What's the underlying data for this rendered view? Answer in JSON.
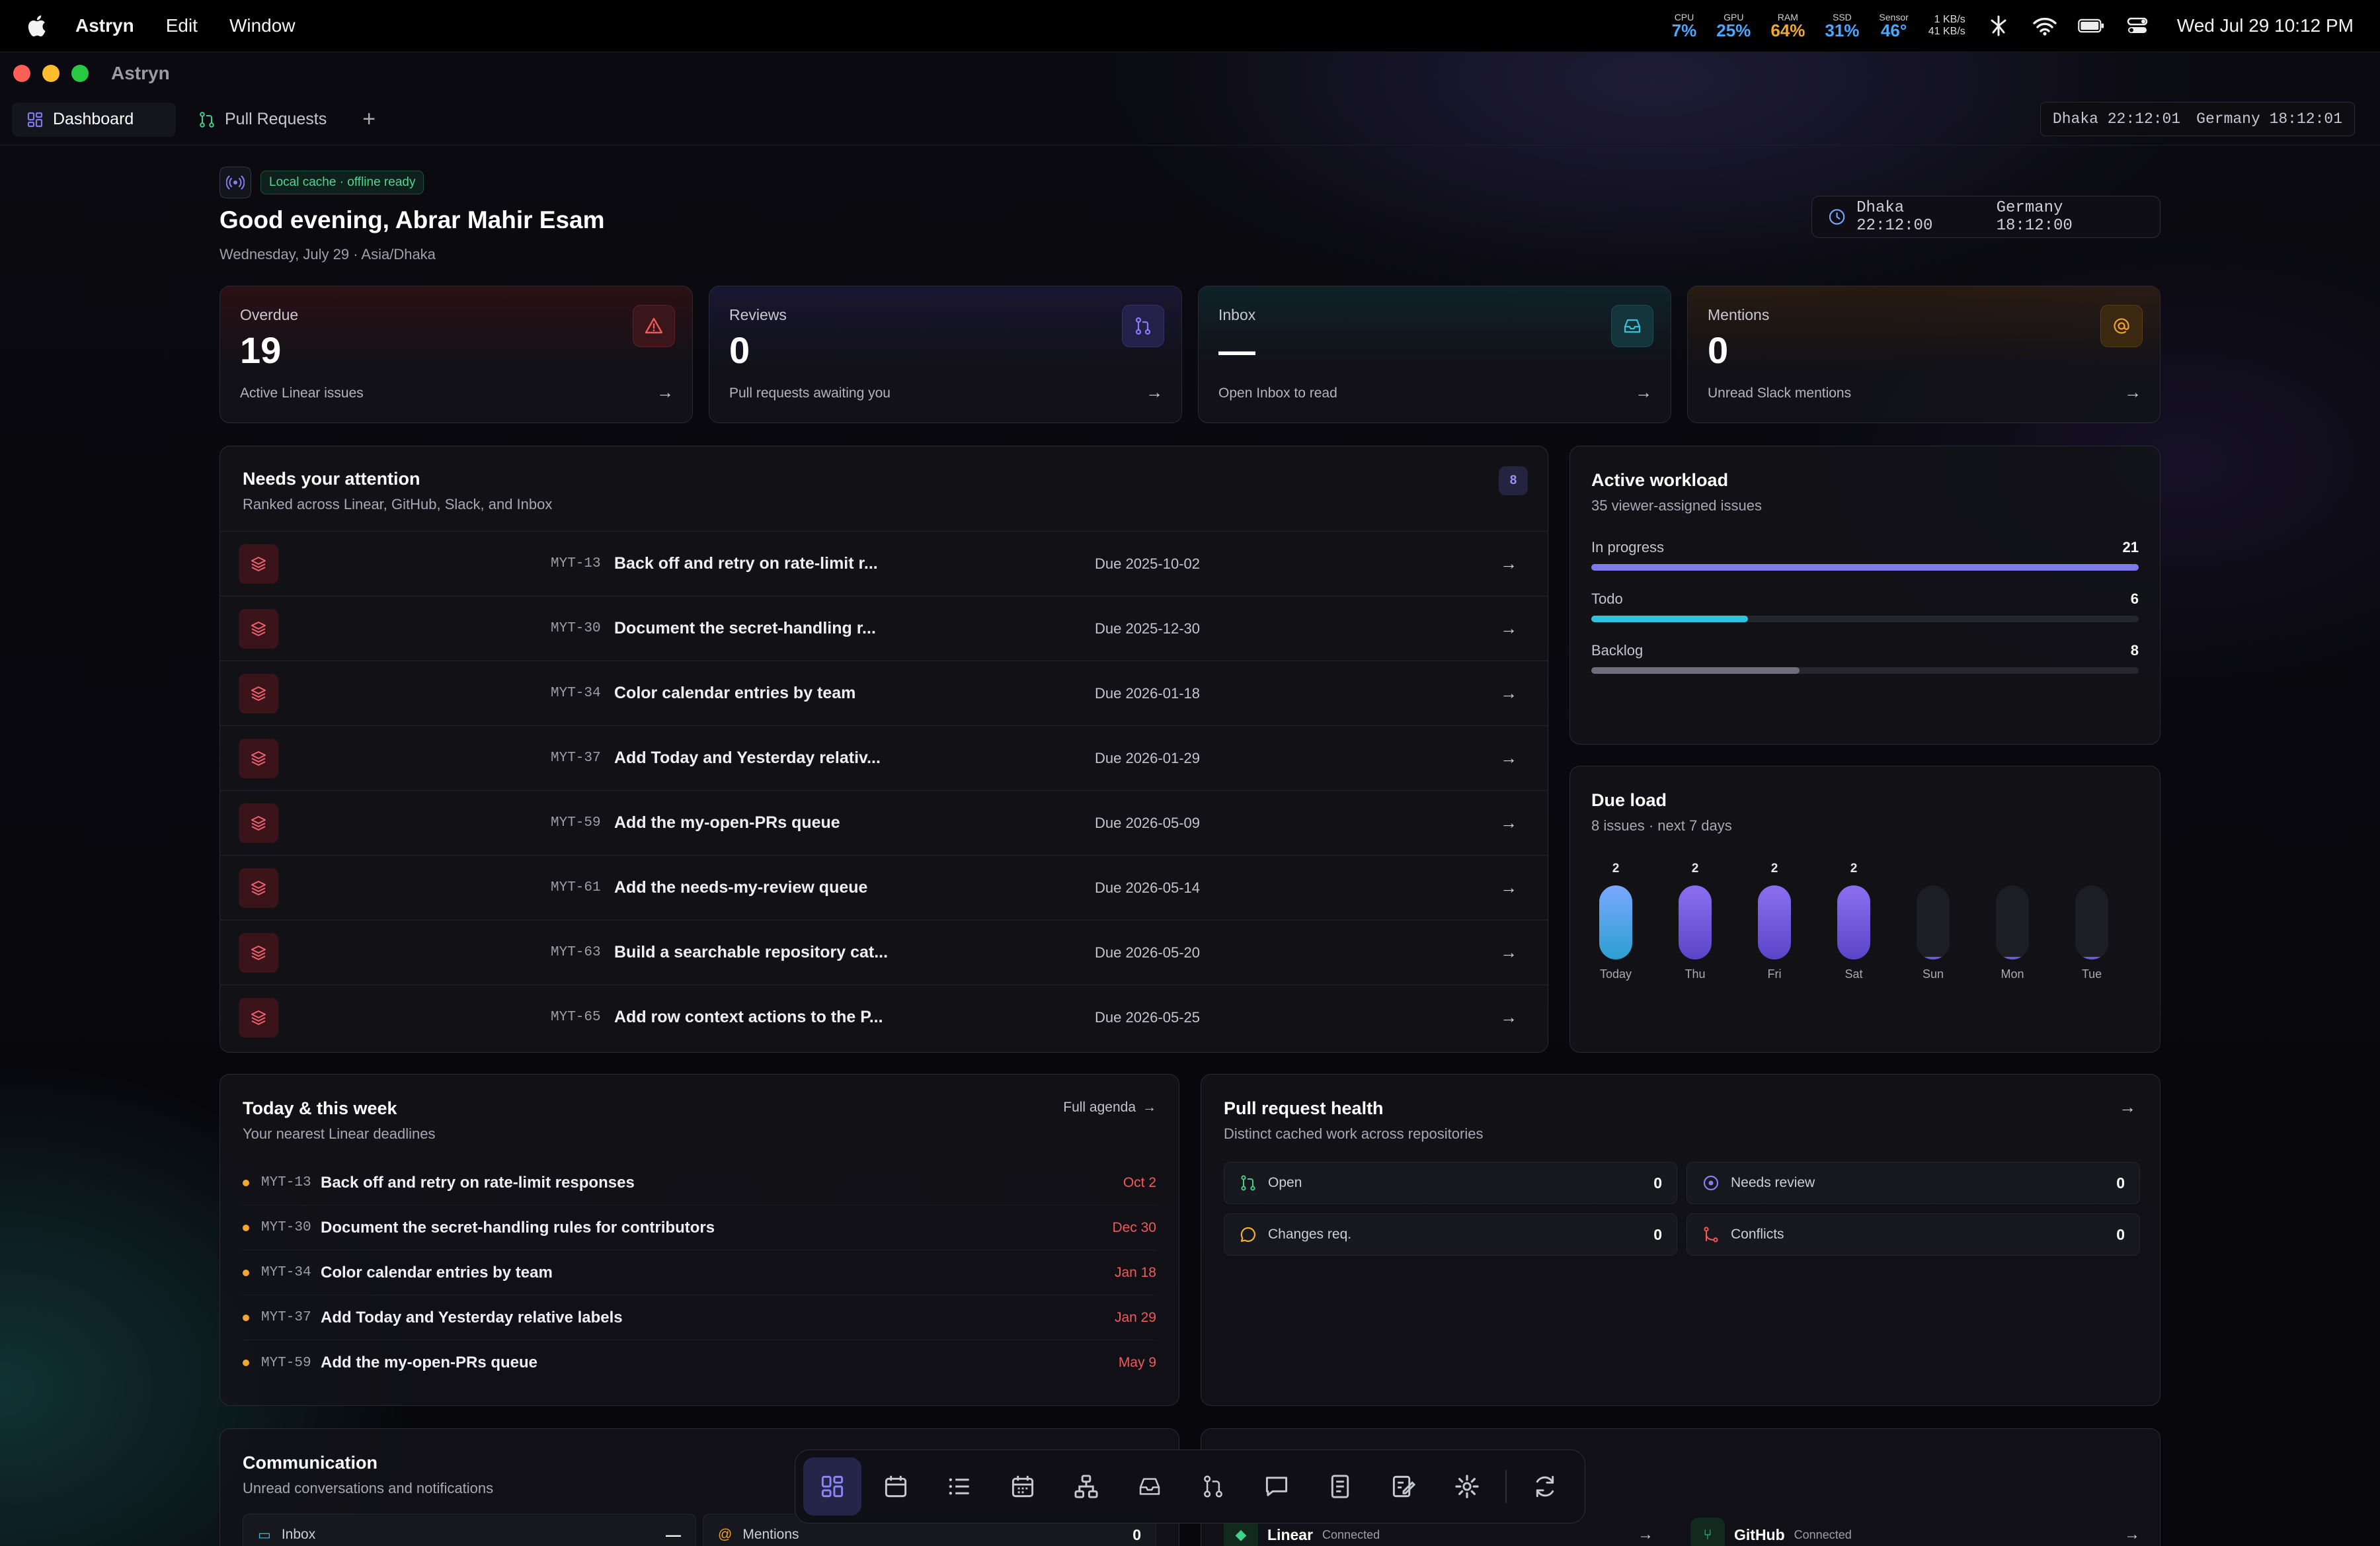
{
  "menubar": {
    "app": "Astryn",
    "edit": "Edit",
    "window": "Window",
    "cpu_label": "CPU",
    "cpu": "7%",
    "gpu_label": "GPU",
    "gpu": "25%",
    "ram_label": "RAM",
    "ram": "64%",
    "ssd_label": "SSD",
    "ssd": "31%",
    "sensor_label": "Sensor",
    "sensor": "46°",
    "net_up": "1 KB/s",
    "net_down": "41 KB/s",
    "clock": "Wed Jul 29  10:12 PM"
  },
  "window": {
    "title": "Astryn"
  },
  "tabs": [
    {
      "label": "Dashboard"
    },
    {
      "label": "Pull Requests"
    }
  ],
  "tab_add": "+",
  "tz_bar": {
    "dhaka": "Dhaka 22:12:01",
    "germany": "Germany 18:12:01"
  },
  "header": {
    "cache_badge": "Local cache · offline ready",
    "greeting": "Good evening, Abrar Mahir Esam",
    "date": "Wednesday, July 29 · Asia/Dhaka",
    "tz_dhaka": "Dhaka 22:12:00",
    "tz_germany": "Germany 18:12:00"
  },
  "stats": [
    {
      "title": "Overdue",
      "value": "19",
      "sub": "Active Linear issues",
      "color": "#f05a5a"
    },
    {
      "title": "Reviews",
      "value": "0",
      "sub": "Pull requests awaiting you",
      "color": "#8a7cf5"
    },
    {
      "title": "Inbox",
      "value": "—",
      "sub": "Open Inbox to read",
      "color": "#3cc0d8"
    },
    {
      "title": "Mentions",
      "value": "0",
      "sub": "Unread Slack mentions",
      "color": "#f0a030"
    }
  ],
  "attention": {
    "title": "Needs your attention",
    "subtitle": "Ranked across Linear, GitHub, Slack, and Inbox",
    "count": "8",
    "rows": [
      {
        "id": "MYT-13",
        "title": "Back off and retry on rate-limit r...",
        "due": "Due 2025-10-02"
      },
      {
        "id": "MYT-30",
        "title": "Document the secret-handling r...",
        "due": "Due 2025-12-30"
      },
      {
        "id": "MYT-34",
        "title": "Color calendar entries by team",
        "due": "Due 2026-01-18"
      },
      {
        "id": "MYT-37",
        "title": "Add Today and Yesterday relativ...",
        "due": "Due 2026-01-29"
      },
      {
        "id": "MYT-59",
        "title": "Add the my-open-PRs queue",
        "due": "Due 2026-05-09"
      },
      {
        "id": "MYT-61",
        "title": "Add the needs-my-review queue",
        "due": "Due 2026-05-14"
      },
      {
        "id": "MYT-63",
        "title": "Build a searchable repository cat...",
        "due": "Due 2026-05-20"
      },
      {
        "id": "MYT-65",
        "title": "Add row context actions to the P...",
        "due": "Due 2026-05-25"
      }
    ]
  },
  "workload": {
    "title": "Active workload",
    "subtitle": "35 viewer-assigned issues",
    "items": [
      {
        "label": "In progress",
        "value": "21",
        "fraction": 1.0,
        "color": "#7d7af0"
      },
      {
        "label": "Todo",
        "value": "6",
        "fraction": 0.286,
        "color": "#2fc2dc"
      },
      {
        "label": "Backlog",
        "value": "8",
        "fraction": 0.381,
        "color": "#6f6f7c"
      }
    ]
  },
  "due_load": {
    "title": "Due load",
    "subtitle": "8 issues · next 7 days",
    "chart_data": {
      "type": "bar",
      "categories": [
        "Today",
        "Thu",
        "Fri",
        "Sat",
        "Sun",
        "Mon",
        "Tue"
      ],
      "values": [
        2,
        2,
        2,
        2,
        0,
        0,
        0
      ],
      "ylim": [
        0,
        2
      ]
    }
  },
  "agenda": {
    "title": "Today & this week",
    "subtitle": "Your nearest Linear deadlines",
    "link": "Full agenda",
    "items": [
      {
        "id": "MYT-13",
        "title": "Back off and retry on rate-limit responses",
        "date": "Oct 2"
      },
      {
        "id": "MYT-30",
        "title": "Document the secret-handling rules for contributors",
        "date": "Dec 30"
      },
      {
        "id": "MYT-34",
        "title": "Color calendar entries by team",
        "date": "Jan 18"
      },
      {
        "id": "MYT-37",
        "title": "Add Today and Yesterday relative labels",
        "date": "Jan 29"
      },
      {
        "id": "MYT-59",
        "title": "Add the my-open-PRs queue",
        "date": "May 9"
      }
    ]
  },
  "pr_health": {
    "title": "Pull request health",
    "subtitle": "Distinct cached work across repositories",
    "items": [
      {
        "label": "Open",
        "value": "0"
      },
      {
        "label": "Needs review",
        "value": "0"
      },
      {
        "label": "Changes req.",
        "value": "0"
      },
      {
        "label": "Conflicts",
        "value": "0"
      }
    ]
  },
  "communication": {
    "title": "Communication",
    "subtitle": "Unread conversations and notifications",
    "inbox_label": "Inbox",
    "inbox_value": "—",
    "mentions_label": "Mentions",
    "mentions_value": "0"
  },
  "integrations": {
    "linear": "Linear",
    "linear_status": "Connected",
    "github": "GitHub",
    "github_status": "Connected"
  }
}
